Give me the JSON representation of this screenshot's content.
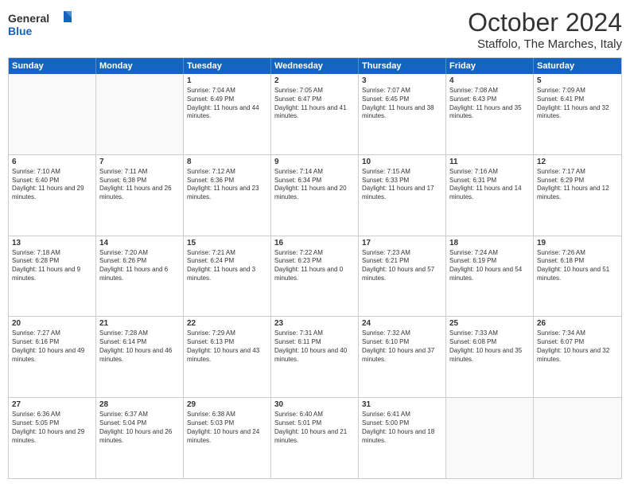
{
  "logo": {
    "line1": "General",
    "line2": "Blue"
  },
  "title": "October 2024",
  "location": "Staffolo, The Marches, Italy",
  "days": [
    "Sunday",
    "Monday",
    "Tuesday",
    "Wednesday",
    "Thursday",
    "Friday",
    "Saturday"
  ],
  "weeks": [
    [
      {
        "day": "",
        "info": ""
      },
      {
        "day": "",
        "info": ""
      },
      {
        "day": "1",
        "info": "Sunrise: 7:04 AM\nSunset: 6:49 PM\nDaylight: 11 hours and 44 minutes."
      },
      {
        "day": "2",
        "info": "Sunrise: 7:05 AM\nSunset: 6:47 PM\nDaylight: 11 hours and 41 minutes."
      },
      {
        "day": "3",
        "info": "Sunrise: 7:07 AM\nSunset: 6:45 PM\nDaylight: 11 hours and 38 minutes."
      },
      {
        "day": "4",
        "info": "Sunrise: 7:08 AM\nSunset: 6:43 PM\nDaylight: 11 hours and 35 minutes."
      },
      {
        "day": "5",
        "info": "Sunrise: 7:09 AM\nSunset: 6:41 PM\nDaylight: 11 hours and 32 minutes."
      }
    ],
    [
      {
        "day": "6",
        "info": "Sunrise: 7:10 AM\nSunset: 6:40 PM\nDaylight: 11 hours and 29 minutes."
      },
      {
        "day": "7",
        "info": "Sunrise: 7:11 AM\nSunset: 6:38 PM\nDaylight: 11 hours and 26 minutes."
      },
      {
        "day": "8",
        "info": "Sunrise: 7:12 AM\nSunset: 6:36 PM\nDaylight: 11 hours and 23 minutes."
      },
      {
        "day": "9",
        "info": "Sunrise: 7:14 AM\nSunset: 6:34 PM\nDaylight: 11 hours and 20 minutes."
      },
      {
        "day": "10",
        "info": "Sunrise: 7:15 AM\nSunset: 6:33 PM\nDaylight: 11 hours and 17 minutes."
      },
      {
        "day": "11",
        "info": "Sunrise: 7:16 AM\nSunset: 6:31 PM\nDaylight: 11 hours and 14 minutes."
      },
      {
        "day": "12",
        "info": "Sunrise: 7:17 AM\nSunset: 6:29 PM\nDaylight: 11 hours and 12 minutes."
      }
    ],
    [
      {
        "day": "13",
        "info": "Sunrise: 7:18 AM\nSunset: 6:28 PM\nDaylight: 11 hours and 9 minutes."
      },
      {
        "day": "14",
        "info": "Sunrise: 7:20 AM\nSunset: 6:26 PM\nDaylight: 11 hours and 6 minutes."
      },
      {
        "day": "15",
        "info": "Sunrise: 7:21 AM\nSunset: 6:24 PM\nDaylight: 11 hours and 3 minutes."
      },
      {
        "day": "16",
        "info": "Sunrise: 7:22 AM\nSunset: 6:23 PM\nDaylight: 11 hours and 0 minutes."
      },
      {
        "day": "17",
        "info": "Sunrise: 7:23 AM\nSunset: 6:21 PM\nDaylight: 10 hours and 57 minutes."
      },
      {
        "day": "18",
        "info": "Sunrise: 7:24 AM\nSunset: 6:19 PM\nDaylight: 10 hours and 54 minutes."
      },
      {
        "day": "19",
        "info": "Sunrise: 7:26 AM\nSunset: 6:18 PM\nDaylight: 10 hours and 51 minutes."
      }
    ],
    [
      {
        "day": "20",
        "info": "Sunrise: 7:27 AM\nSunset: 6:16 PM\nDaylight: 10 hours and 49 minutes."
      },
      {
        "day": "21",
        "info": "Sunrise: 7:28 AM\nSunset: 6:14 PM\nDaylight: 10 hours and 46 minutes."
      },
      {
        "day": "22",
        "info": "Sunrise: 7:29 AM\nSunset: 6:13 PM\nDaylight: 10 hours and 43 minutes."
      },
      {
        "day": "23",
        "info": "Sunrise: 7:31 AM\nSunset: 6:11 PM\nDaylight: 10 hours and 40 minutes."
      },
      {
        "day": "24",
        "info": "Sunrise: 7:32 AM\nSunset: 6:10 PM\nDaylight: 10 hours and 37 minutes."
      },
      {
        "day": "25",
        "info": "Sunrise: 7:33 AM\nSunset: 6:08 PM\nDaylight: 10 hours and 35 minutes."
      },
      {
        "day": "26",
        "info": "Sunrise: 7:34 AM\nSunset: 6:07 PM\nDaylight: 10 hours and 32 minutes."
      }
    ],
    [
      {
        "day": "27",
        "info": "Sunrise: 6:36 AM\nSunset: 5:05 PM\nDaylight: 10 hours and 29 minutes."
      },
      {
        "day": "28",
        "info": "Sunrise: 6:37 AM\nSunset: 5:04 PM\nDaylight: 10 hours and 26 minutes."
      },
      {
        "day": "29",
        "info": "Sunrise: 6:38 AM\nSunset: 5:03 PM\nDaylight: 10 hours and 24 minutes."
      },
      {
        "day": "30",
        "info": "Sunrise: 6:40 AM\nSunset: 5:01 PM\nDaylight: 10 hours and 21 minutes."
      },
      {
        "day": "31",
        "info": "Sunrise: 6:41 AM\nSunset: 5:00 PM\nDaylight: 10 hours and 18 minutes."
      },
      {
        "day": "",
        "info": ""
      },
      {
        "day": "",
        "info": ""
      }
    ]
  ]
}
